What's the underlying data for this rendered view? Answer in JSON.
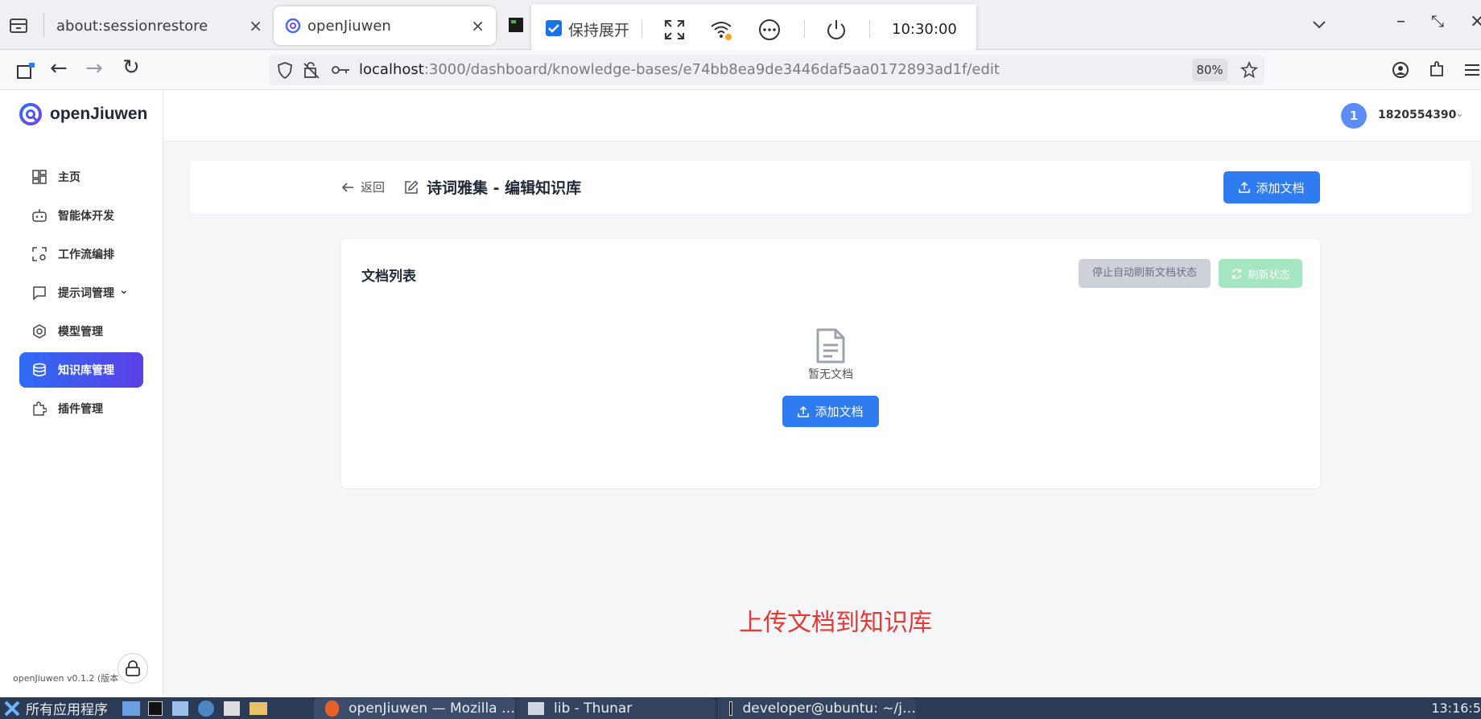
{
  "browser": {
    "tabs": [
      {
        "label": "about:sessionrestore",
        "close": "×"
      },
      {
        "label": "openJiuwen",
        "close": "×"
      }
    ],
    "remote_toolbar": {
      "keep_expanded_label": "保持展开",
      "clock": "10:30:00"
    },
    "url": {
      "host": "localhost",
      "path": ":3000/dashboard/knowledge-bases/e74bb8ea9de3446daf5aa0172893ad1f/edit"
    },
    "zoom": "80%",
    "window_controls": {
      "minimize": "–",
      "restore": "⤡",
      "close": "×"
    }
  },
  "app": {
    "logo_text": "openJiuwen",
    "sidebar": {
      "items": [
        {
          "label": "主页",
          "icon": "dashboard-icon"
        },
        {
          "label": "智能体开发",
          "icon": "robot-icon"
        },
        {
          "label": "工作流编排",
          "icon": "workflow-icon"
        },
        {
          "label": "提示词管理",
          "icon": "chat-icon"
        },
        {
          "label": "模型管理",
          "icon": "model-icon"
        },
        {
          "label": "知识库管理",
          "icon": "database-icon"
        },
        {
          "label": "插件管理",
          "icon": "plugin-icon"
        }
      ],
      "prompt_caret": "⌄",
      "version": "openJiuwen v0.1.2 (版本"
    },
    "user": {
      "avatar_text": "1",
      "name": "1820554390",
      "caret": "⌄"
    },
    "header": {
      "back_label": "返回",
      "title": "诗词雅集 - 编辑知识库",
      "add_doc_label": "添加文档"
    },
    "doc_list": {
      "title": "文档列表",
      "stop_refresh_label": "停止自动刷新文档状态",
      "refresh_label": "刷新状态",
      "empty_text": "暂无文档",
      "add_doc_label": "添加文档"
    },
    "caption": "上传文档到知识库"
  },
  "taskbar": {
    "start_label": "所有应用程序",
    "windows": [
      {
        "label": "openJiuwen — Mozilla …"
      },
      {
        "label": "lib - Thunar"
      },
      {
        "label": "developer@ubuntu: ~/j…"
      }
    ],
    "clock": "13:16:5"
  },
  "colors": {
    "primary": "#2f7bf0",
    "sidebar_active_start": "#2e6cf6",
    "sidebar_active_end": "#5b3fe6",
    "refresh_button": "#a3e6bf",
    "caption": "#e53935",
    "taskbar": "#2b3a55"
  }
}
